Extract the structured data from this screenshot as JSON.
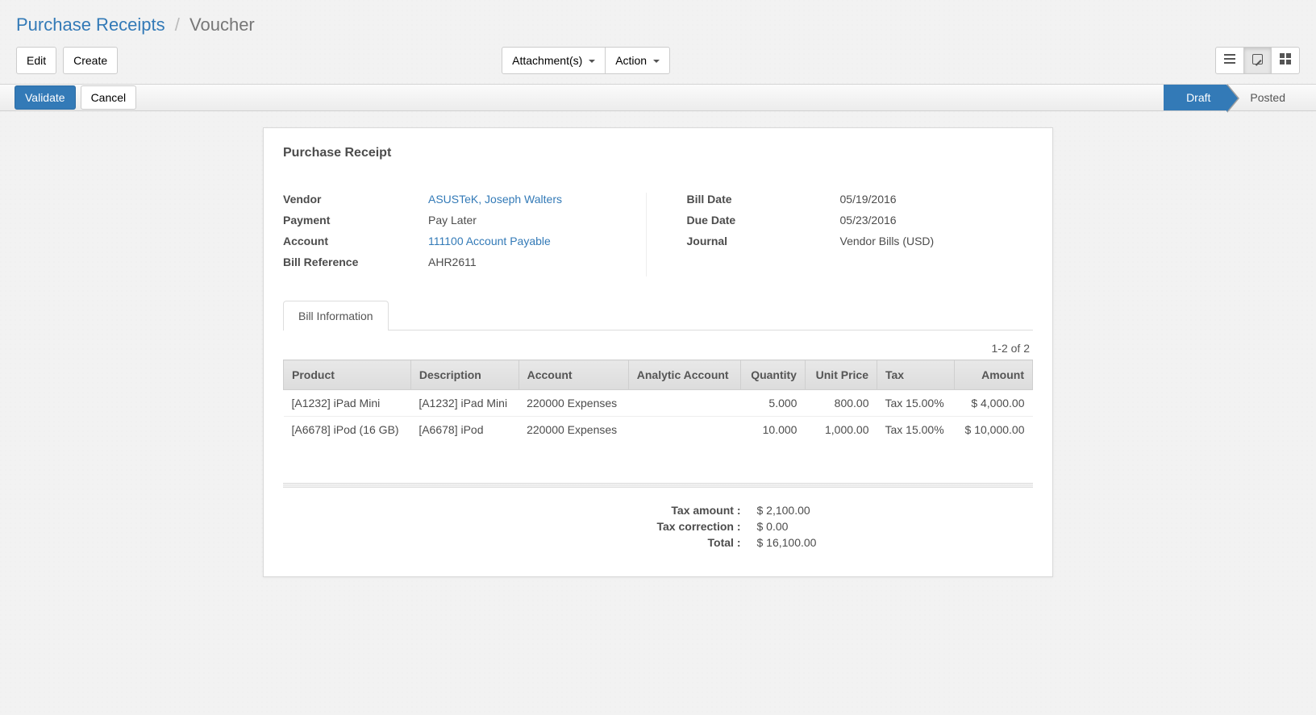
{
  "breadcrumb": {
    "root": "Purchase Receipts",
    "current": "Voucher"
  },
  "topButtons": {
    "edit": "Edit",
    "create": "Create",
    "attachments": "Attachment(s)",
    "action": "Action"
  },
  "statusbar": {
    "validate": "Validate",
    "cancel": "Cancel",
    "steps": {
      "draft": "Draft",
      "posted": "Posted"
    }
  },
  "sheet": {
    "title": "Purchase Receipt",
    "labels": {
      "vendor": "Vendor",
      "payment": "Payment",
      "account": "Account",
      "bill_ref": "Bill Reference",
      "bill_date": "Bill Date",
      "due_date": "Due Date",
      "journal": "Journal"
    },
    "values": {
      "vendor": "ASUSTeK, Joseph Walters",
      "payment": "Pay Later",
      "account": "111100 Account Payable",
      "bill_ref": "AHR2611",
      "bill_date": "05/19/2016",
      "due_date": "05/23/2016",
      "journal": "Vendor Bills (USD)"
    }
  },
  "tabs": {
    "bill_info": "Bill Information"
  },
  "table": {
    "pager": "1-2 of 2",
    "headers": {
      "product": "Product",
      "description": "Description",
      "account": "Account",
      "analytic": "Analytic Account",
      "quantity": "Quantity",
      "unit_price": "Unit Price",
      "tax": "Tax",
      "amount": "Amount"
    },
    "rows": [
      {
        "product": "[A1232] iPad Mini",
        "description": "[A1232] iPad Mini",
        "account": "220000 Expenses",
        "analytic": "",
        "quantity": "5.000",
        "unit_price": "800.00",
        "tax": "Tax 15.00%",
        "amount": "$ 4,000.00"
      },
      {
        "product": "[A6678] iPod (16 GB)",
        "description": "[A6678] iPod",
        "account": "220000 Expenses",
        "analytic": "",
        "quantity": "10.000",
        "unit_price": "1,000.00",
        "tax": "Tax 15.00%",
        "amount": "$ 10,000.00"
      }
    ]
  },
  "totals": {
    "labels": {
      "tax_amount": "Tax amount :",
      "tax_correction": "Tax correction :",
      "total": "Total :"
    },
    "values": {
      "tax_amount": "$ 2,100.00",
      "tax_correction": "$ 0.00",
      "total": "$ 16,100.00"
    }
  }
}
